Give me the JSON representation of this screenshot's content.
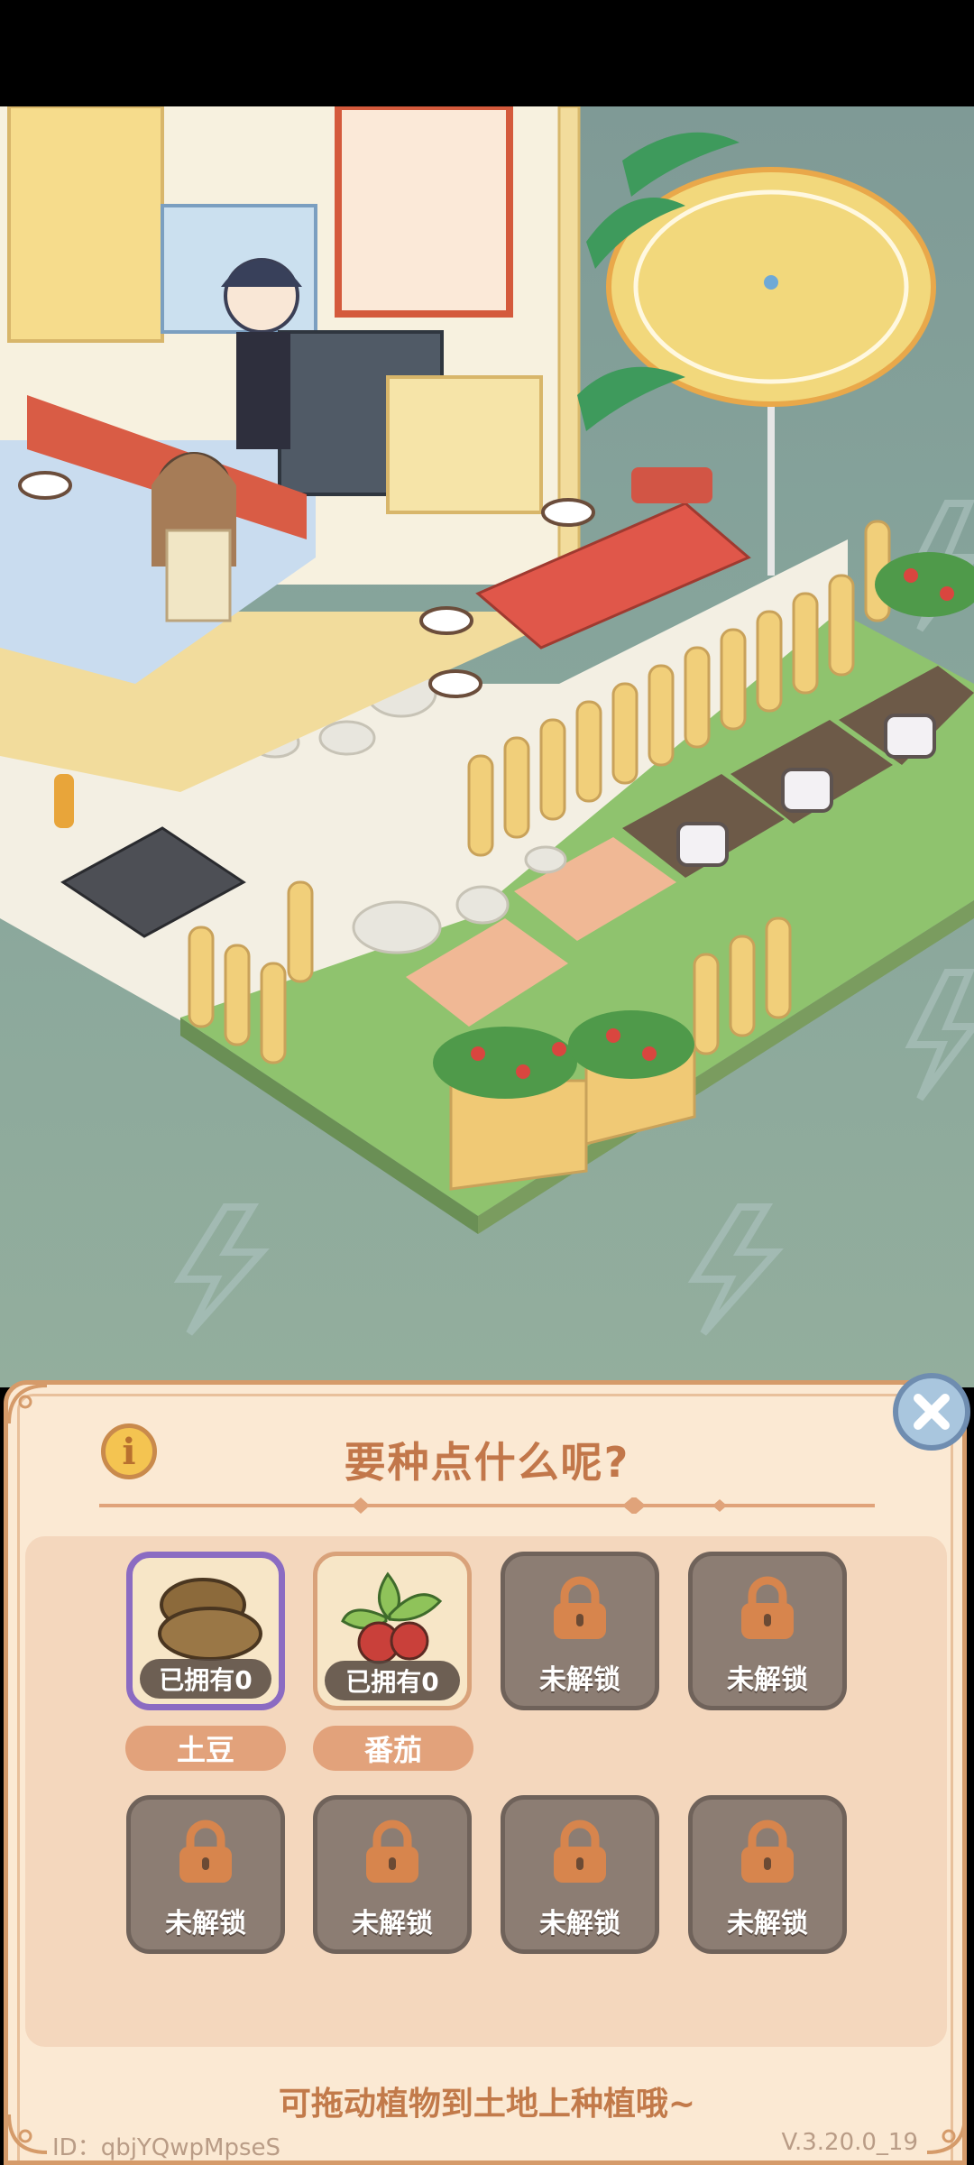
{
  "panel": {
    "title": "要种点什么呢?",
    "hint": "可拖动植物到土地上种植哦~",
    "player_id": "ID：qbjYQwpMpseS",
    "version": "V.3.20.0_19"
  },
  "plants": [
    {
      "name": "土豆",
      "status": "已拥有0",
      "selected": true,
      "icon": "potato-icon"
    },
    {
      "name": "番茄",
      "status": "已拥有0",
      "selected": false,
      "icon": "tomato-icon"
    },
    {
      "status": "未解锁",
      "icon": "lock-icon"
    },
    {
      "status": "未解锁",
      "icon": "lock-icon"
    },
    {
      "status": "未解锁",
      "icon": "lock-icon"
    },
    {
      "status": "未解锁",
      "icon": "lock-icon"
    },
    {
      "status": "未解锁",
      "icon": "lock-icon"
    },
    {
      "status": "未解锁",
      "icon": "lock-icon"
    }
  ],
  "scene": {
    "icons": [
      "lightning-bolt-icon",
      "umbrella-icon",
      "padlock-icon"
    ]
  },
  "colors": {
    "panel_bg": "#fbe9d3",
    "panel_border": "#d59b6a",
    "title": "#c2774a",
    "selected_border": "#8b6bc2",
    "locked_slot": "#8c7d73",
    "name_pill": "#e2a27b"
  }
}
